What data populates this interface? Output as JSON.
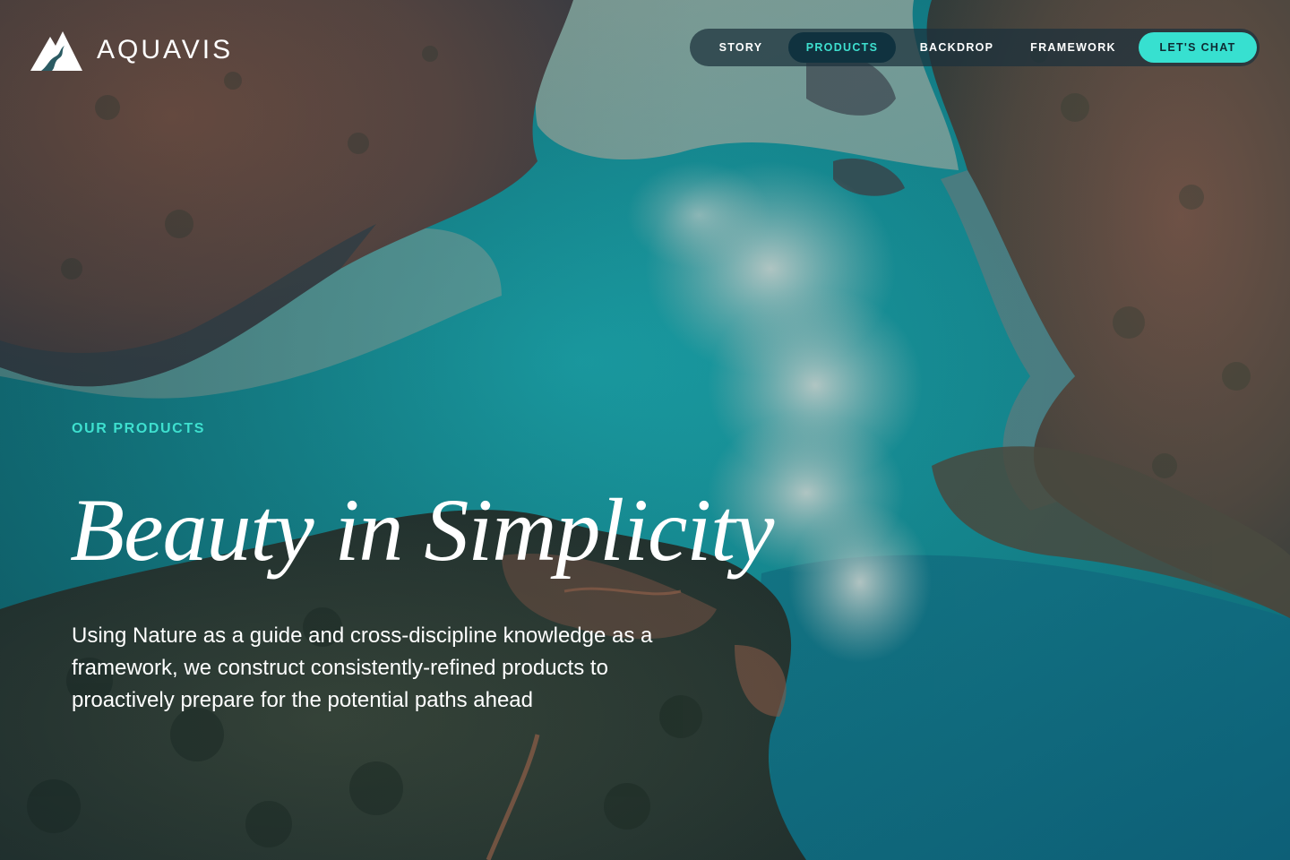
{
  "brand": {
    "name": "AQUAVIS",
    "logo_icon": "mountain-river-logo-icon"
  },
  "nav": {
    "items": [
      {
        "label": "STORY"
      },
      {
        "label": "PRODUCTS",
        "active": true
      },
      {
        "label": "BACKDROP"
      },
      {
        "label": "FRAMEWORK"
      }
    ],
    "cta_label": "LET'S CHAT"
  },
  "hero": {
    "eyebrow": "OUR PRODUCTS",
    "title": "Beauty in Simplicity",
    "body": "Using Nature as a guide and cross-discipline knowledge as a framework, we construct consistently-refined products to proactively prepare for the potential paths ahead"
  },
  "colors": {
    "accent": "#37e0d0",
    "accent_text": "#3ee0cf",
    "nav_bg": "#1c303c",
    "nav_active_bg": "#10323f"
  }
}
